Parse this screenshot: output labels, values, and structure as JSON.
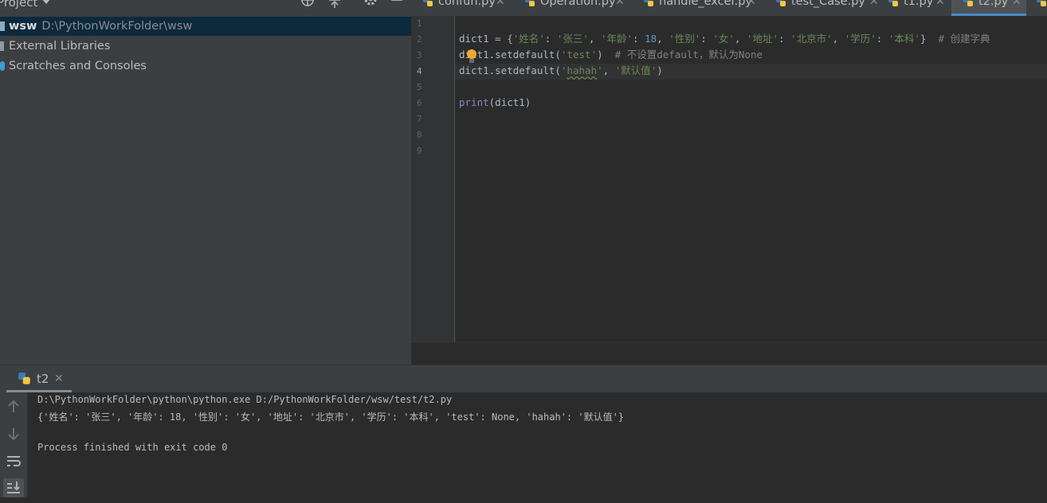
{
  "project_panel": {
    "title": "Project",
    "tree": {
      "root_name": "wsw",
      "root_path": "D:\\PythonWorkFolder\\wsw",
      "external_libraries": "External Libraries",
      "scratches": "Scratches and Consoles"
    },
    "icons": [
      "crosshair-icon",
      "collapse-icon",
      "gear-icon",
      "minimize-icon"
    ]
  },
  "editor": {
    "tabs": [
      {
        "label": "confun.py",
        "active": false
      },
      {
        "label": "Operation.py",
        "active": false
      },
      {
        "label": "handle_excel.py",
        "active": false
      },
      {
        "label": "test_Case.py",
        "active": false
      },
      {
        "label": "t1.py",
        "active": false
      },
      {
        "label": "t2.py",
        "active": true
      }
    ],
    "line_numbers": [
      "1",
      "2",
      "3",
      "4",
      "5",
      "6",
      "7",
      "8",
      "9"
    ],
    "current_line": "4",
    "code": {
      "line2": {
        "var": "dict1 = {",
        "k1": "'姓名'",
        "sep1": ": ",
        "v1": "'张三'",
        "c1": ", ",
        "k2": "'年龄'",
        "sep2": ": ",
        "v2": "18",
        "c2": ", ",
        "k3": "'性别'",
        "sep3": ": ",
        "v3": "'女'",
        "c3": ", ",
        "k4": "'地址'",
        "sep4": ": ",
        "v4": "'北京市'",
        "c4": ", ",
        "k5": "'学历'",
        "sep5": ": ",
        "v5": "'本科'",
        "end": "}  ",
        "comment": "# 创建字典"
      },
      "line3": {
        "call": "dict1.setdefault(",
        "arg": "'test'",
        "close": ")  ",
        "comment": "# 不设置default，默认为None"
      },
      "line4": {
        "call": "dict1.setdefault(",
        "q1": "'",
        "arg1": "hahah",
        "q2": "'",
        "sep": ", ",
        "arg2": "'默认值'",
        "close": ")"
      },
      "line6": {
        "func": "print",
        "args": "(dict1)"
      }
    }
  },
  "run_panel": {
    "tab_label": "t2",
    "output": [
      "D:\\PythonWorkFolder\\python\\python.exe D:/PythonWorkFolder/wsw/test/t2.py",
      "{'姓名': '张三', '年龄': 18, '性别': '女', '地址': '北京市', '学历': '本科', 'test': None, 'hahah': '默认值'}",
      "",
      "Process finished with exit code 0"
    ],
    "tools": [
      "up-arrow-icon",
      "down-arrow-icon",
      "soft-wrap-icon",
      "scroll-to-end-icon"
    ]
  },
  "colors": {
    "background": "#2b2b2b",
    "panel": "#3c3f41",
    "selection": "#0d293e",
    "string": "#6a8759",
    "number": "#6897bb",
    "comment": "#808080",
    "code": "#a9b7c6",
    "active_tab_underline": "#4a88c7"
  }
}
